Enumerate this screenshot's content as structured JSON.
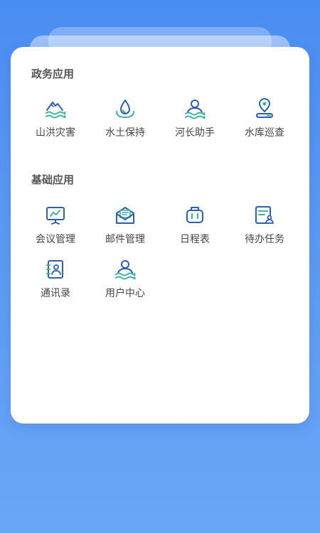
{
  "sections": [
    {
      "title": "政务应用",
      "items": [
        {
          "label": "山洪灾害",
          "icon": "mountain-flood-icon"
        },
        {
          "label": "水土保持",
          "icon": "water-drop-icon"
        },
        {
          "label": "河长助手",
          "icon": "river-chief-icon"
        },
        {
          "label": "水库巡查",
          "icon": "location-pin-icon"
        }
      ]
    },
    {
      "title": "基础应用",
      "items": [
        {
          "label": "会议管理",
          "icon": "presentation-board-icon"
        },
        {
          "label": "邮件管理",
          "icon": "mail-icon"
        },
        {
          "label": "日程表",
          "icon": "schedule-icon"
        },
        {
          "label": "待办任务",
          "icon": "task-list-icon"
        },
        {
          "label": "通讯录",
          "icon": "contacts-icon"
        },
        {
          "label": "用户中心",
          "icon": "user-center-icon"
        }
      ]
    }
  ],
  "colors": {
    "icon_dark": "#2f5fa8",
    "icon_accent": "#3fb3a3",
    "background": "#4a8df2"
  }
}
